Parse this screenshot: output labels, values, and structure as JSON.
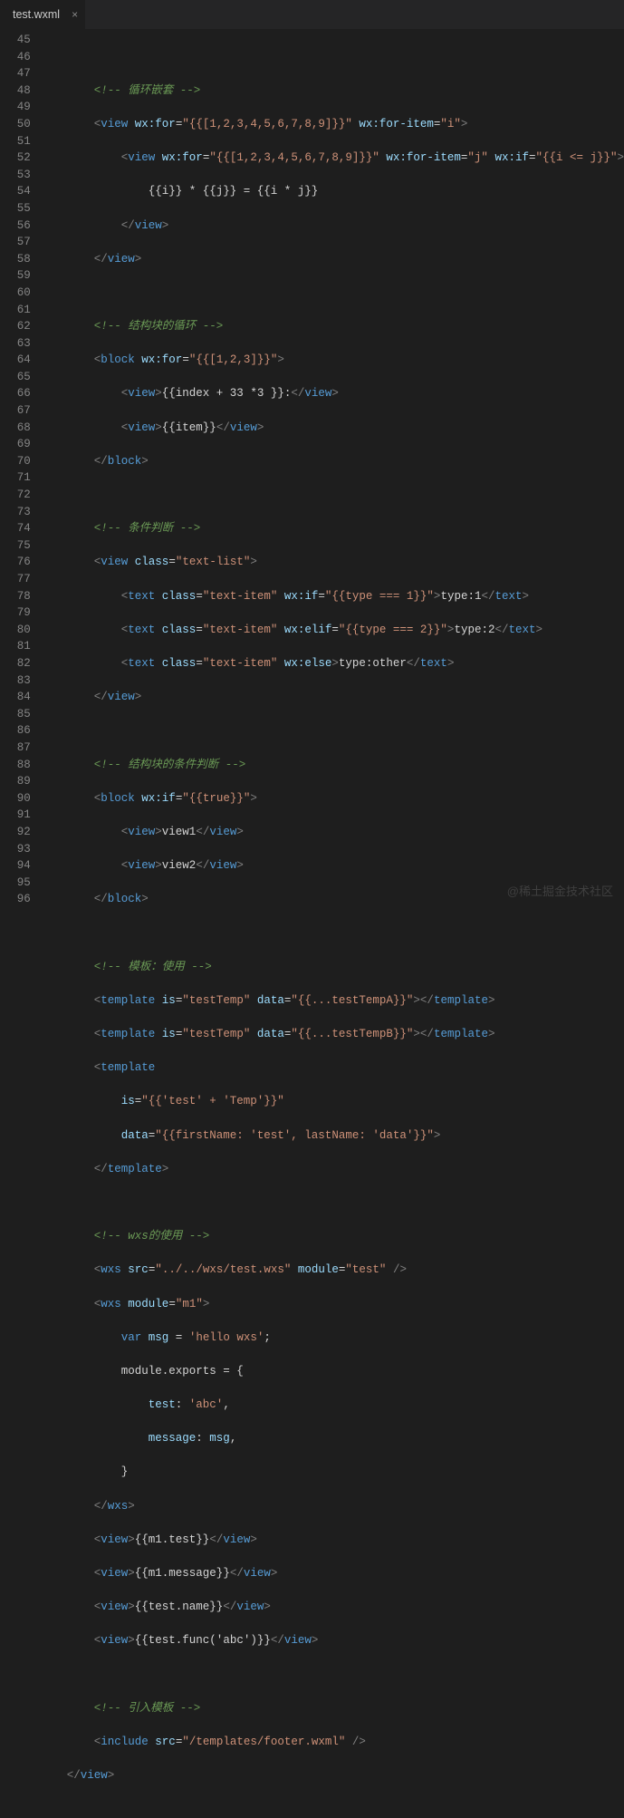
{
  "tab": {
    "label": "test.wxml",
    "close": "×"
  },
  "startLine": 45,
  "endLine": 96,
  "watermark": "@稀土掘金技术社区",
  "lines": {
    "l46": {
      "indent": "        ",
      "cmnt": "<!-- 循环嵌套 -->"
    },
    "l47": {
      "indent": "        ",
      "tag": "view",
      "attr1": "wx:for",
      "val1": "\"{{[1,2,3,4,5,6,7,8,9]}}\"",
      "attr2": "wx:for-item",
      "val2": "\"i\""
    },
    "l48": {
      "indent": "            ",
      "tag": "view",
      "attr1": "wx:for",
      "val1": "\"{{[1,2,3,4,5,6,7,8,9]}}\"",
      "attr2": "wx:for-item",
      "val2": "\"j\"",
      "attr3": "wx:if",
      "val3": "\"{{i <= j}}\""
    },
    "l49": {
      "indent": "                ",
      "txt": "{{i}} * {{j}} = {{i * j}}"
    },
    "l50": {
      "indent": "            ",
      "tag": "view"
    },
    "l51": {
      "indent": "        ",
      "tag": "view"
    },
    "l53": {
      "indent": "        ",
      "cmnt": "<!-- 结构块的循环 -->"
    },
    "l54": {
      "indent": "        ",
      "tag": "block",
      "attr1": "wx:for",
      "val1": "\"{{[1,2,3]}}\""
    },
    "l55": {
      "indent": "            ",
      "tag": "view",
      "txt": "{{index + 33 *3 }}:"
    },
    "l56": {
      "indent": "            ",
      "tag": "view",
      "txt": "{{item}}"
    },
    "l57": {
      "indent": "        ",
      "tag": "block"
    },
    "l59": {
      "indent": "        ",
      "cmnt": "<!-- 条件判断 -->"
    },
    "l60": {
      "indent": "        ",
      "tag": "view",
      "attr1": "class",
      "val1": "\"text-list\""
    },
    "l61": {
      "indent": "            ",
      "tag": "text",
      "attr1": "class",
      "val1": "\"text-item\"",
      "attr2": "wx:if",
      "val2": "\"{{type === 1}}\"",
      "txt": "type:1"
    },
    "l62": {
      "indent": "            ",
      "tag": "text",
      "attr1": "class",
      "val1": "\"text-item\"",
      "attr2": "wx:elif",
      "val2": "\"{{type === 2}}\"",
      "txt": "type:2"
    },
    "l63": {
      "indent": "            ",
      "tag": "text",
      "attr1": "class",
      "val1": "\"text-item\"",
      "attr2": "wx:else",
      "txt": "type:other"
    },
    "l64": {
      "indent": "        ",
      "tag": "view"
    },
    "l66": {
      "indent": "        ",
      "cmnt": "<!-- 结构块的条件判断 -->"
    },
    "l67": {
      "indent": "        ",
      "tag": "block",
      "attr1": "wx:if",
      "val1": "\"{{true}}\""
    },
    "l68": {
      "indent": "            ",
      "tag": "view",
      "txt": "view1"
    },
    "l69": {
      "indent": "            ",
      "tag": "view",
      "txt": "view2"
    },
    "l70": {
      "indent": "        ",
      "tag": "block"
    },
    "l72": {
      "indent": "        ",
      "cmnt": "<!-- 模板：使用 -->"
    },
    "l73": {
      "indent": "        ",
      "tag": "template",
      "attr1": "is",
      "val1": "\"testTemp\"",
      "attr2": "data",
      "val2": "\"{{...testTempA}}\""
    },
    "l74": {
      "indent": "        ",
      "tag": "template",
      "attr1": "is",
      "val1": "\"testTemp\"",
      "attr2": "data",
      "val2": "\"{{...testTempB}}\""
    },
    "l75": {
      "indent": "        ",
      "tag": "template"
    },
    "l76": {
      "indent": "            ",
      "attr1": "is",
      "val1": "\"{{'test' + 'Temp'}}\""
    },
    "l77": {
      "indent": "            ",
      "attr1": "data",
      "val1": "\"{{firstName: 'test', lastName: 'data'}}\""
    },
    "l78": {
      "indent": "        ",
      "tag": "template"
    },
    "l80": {
      "indent": "        ",
      "cmnt": "<!-- wxs的使用 -->"
    },
    "l81": {
      "indent": "        ",
      "tag": "wxs",
      "attr1": "src",
      "val1": "\"../../wxs/test.wxs\"",
      "attr2": "module",
      "val2": "\"test\""
    },
    "l82": {
      "indent": "        ",
      "tag": "wxs",
      "attr1": "module",
      "val1": "\"m1\""
    },
    "l83": {
      "indent": "            ",
      "kw": "var",
      "var": "msg",
      "eq": " = ",
      "str": "'hello wxs'",
      "sc": ";"
    },
    "l84": {
      "indent": "            ",
      "txt": "module.exports = {"
    },
    "l85": {
      "indent": "                ",
      "key": "test",
      "val": "'abc'",
      "comma": ","
    },
    "l86": {
      "indent": "                ",
      "key": "message",
      "valvar": "msg",
      "comma": ","
    },
    "l87": {
      "indent": "            ",
      "txt": "}"
    },
    "l88": {
      "indent": "        ",
      "tag": "wxs"
    },
    "l89": {
      "indent": "        ",
      "tag": "view",
      "txt": "{{m1.test}}"
    },
    "l90": {
      "indent": "        ",
      "tag": "view",
      "txt": "{{m1.message}}"
    },
    "l91": {
      "indent": "        ",
      "tag": "view",
      "txt": "{{test.name}}"
    },
    "l92": {
      "indent": "        ",
      "tag": "view",
      "txt": "{{test.func('abc')}}"
    },
    "l94": {
      "indent": "        ",
      "cmnt": "<!-- 引入模板 -->"
    },
    "l95": {
      "indent": "        ",
      "tag": "include",
      "attr1": "src",
      "val1": "\"/templates/footer.wxml\""
    },
    "l96": {
      "indent": "    ",
      "tag": "view"
    }
  }
}
